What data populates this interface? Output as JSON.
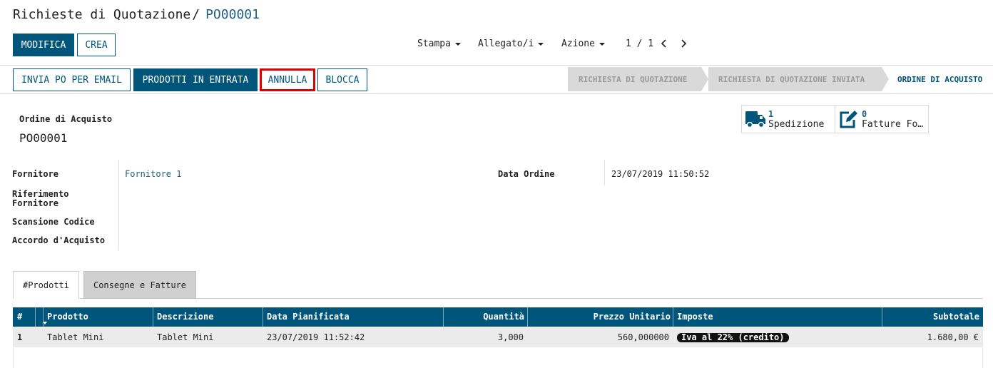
{
  "breadcrumb": {
    "parent": "Richieste di Quotazione",
    "separator": "/",
    "current": "PO00001"
  },
  "control": {
    "edit_label": "MODIFICA",
    "create_label": "CREA",
    "print_label": "Stampa",
    "attachments_label": "Allegato/i",
    "action_label": "Azione",
    "pager": "1 / 1"
  },
  "header_buttons": {
    "email_po": "INVIA PO PER EMAIL",
    "receive_products": "PRODOTTI IN ENTRATA",
    "cancel": "ANNULLA",
    "lock": "BLOCCA"
  },
  "statusbar": [
    "RICHIESTA DI QUOTAZIONE",
    "RICHIESTA DI QUOTAZIONE INVIATA",
    "ORDINE DI ACQUISTO"
  ],
  "smart_buttons": [
    {
      "count": "1",
      "label": "Spedizione",
      "icon": "truck-icon"
    },
    {
      "count": "0",
      "label": "Fatture Fo…",
      "icon": "edit-icon"
    }
  ],
  "form": {
    "title_label": "Ordine di Acquisto",
    "name": "PO00001",
    "vendor_label": "Fornitore",
    "vendor": "Fornitore 1",
    "vendor_ref_label_1": "Riferimento",
    "vendor_ref_label_2": "Fornitore",
    "scan_label": "Scansione Codice",
    "agreement_label": "Accordo d'Acquisto",
    "order_date_label": "Data Ordine",
    "order_date": "23/07/2019 11:50:52"
  },
  "tabs": [
    "#Prodotti",
    "Consegne e Fatture"
  ],
  "table": {
    "headers": [
      "#",
      "Prodotto",
      "Descrizione",
      "Data Pianificata",
      "Quantità",
      "Prezzo Unitario",
      "Imposte",
      "Subtotale"
    ],
    "rows": [
      {
        "seq": "1",
        "product": "Tablet Mini",
        "description": "Tablet Mini",
        "date": "23/07/2019 11:52:42",
        "qty": "3,000",
        "unit_price": "560,000000",
        "tax": "Iva al 22% (credito)",
        "subtotal": "1.680,00 €"
      }
    ]
  },
  "colors": {
    "primary": "#00557a",
    "highlight": "#e00000",
    "link": "#1f5f82"
  }
}
